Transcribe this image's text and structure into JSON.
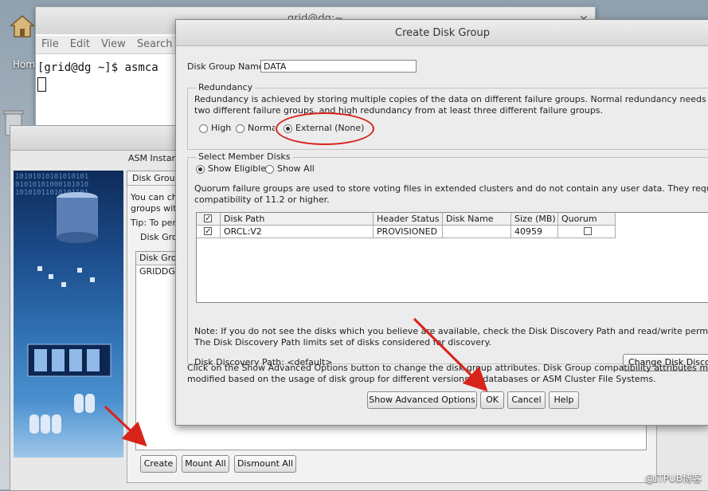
{
  "desktop": {
    "home_label": "Hom"
  },
  "terminal": {
    "title": "grid@dg:~",
    "menu": [
      "File",
      "Edit",
      "View",
      "Search"
    ],
    "prompt_line": "[grid@dg ~]$ asmca"
  },
  "asmca": {
    "instance_label": "ASM Instan",
    "tab_label": "Disk Group",
    "intro1": "You can ch",
    "intro2": "groups with",
    "tip": "Tip: To pert",
    "group_legend": "Disk Gro",
    "list_header": "Disk Gro",
    "list_row": "GRIDDG",
    "buttons": {
      "create": "Create",
      "mount_all": "Mount All",
      "dismount_all": "Dismount All"
    }
  },
  "dialog": {
    "title": "Create Disk Group",
    "name_label": "Disk Group Name",
    "name_value": "DATA",
    "redundancy": {
      "legend": "Redundancy",
      "desc1": "Redundancy is achieved by storing multiple copies of the data on different failure groups. Normal redundancy needs disks fro",
      "desc2": "two different failure groups, and high redundancy from at least three different failure groups.",
      "options": [
        "High",
        "Normal",
        "External (None)"
      ],
      "selected": "External (None)"
    },
    "member": {
      "legend": "Select Member Disks",
      "options": [
        "Show Eligible",
        "Show All"
      ],
      "selected": "Show Eligible",
      "quorum1": "Quorum failure groups are used to store voting files in extended clusters and do not contain any user data. They require ASM",
      "quorum2": "compatibility of 11.2 or higher.",
      "columns": [
        "",
        "Disk Path",
        "Header Status",
        "Disk Name",
        "Size (MB)",
        "Quorum"
      ],
      "rows": [
        {
          "checked": true,
          "path": "ORCL:V2",
          "status": "PROVISIONED",
          "name": "",
          "size": "40959",
          "quorum": false
        }
      ],
      "note1": "Note: If you do not see the disks which you believe are available, check the Disk Discovery Path and read/write permissions on",
      "note2": "The Disk Discovery Path limits set of disks considered for discovery.",
      "discovery_label": "Disk Discovery Path: <default>",
      "change_button": "Change Disk Discov"
    },
    "advanced1": "Click on the Show Advanced Options button to change the disk group attributes. Disk Group compatibility attributes may need t",
    "advanced2": "modified based on the usage of disk group for different versions of databases or ASM Cluster File Systems.",
    "buttons": {
      "advanced": "Show Advanced Options",
      "ok": "OK",
      "cancel": "Cancel",
      "help": "Help"
    }
  },
  "watermark": "@ITPUB博客",
  "colors": {
    "annotation": "#d8231b",
    "art": "#1c4d8c"
  }
}
